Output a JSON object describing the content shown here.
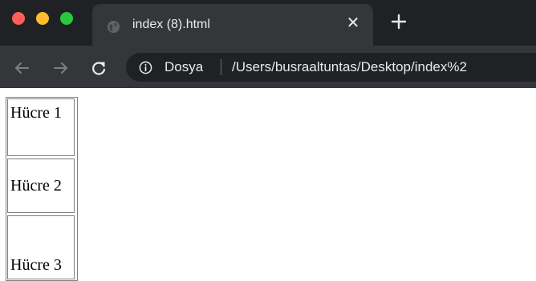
{
  "browser": {
    "tab": {
      "title": "index (8).html",
      "close_glyph": "✕"
    },
    "toolbar": {
      "icons": [
        "back-arrow-icon",
        "forward-arrow-icon",
        "reload-icon"
      ],
      "omnibox": {
        "scheme_label": "Dosya",
        "url": "/Users/busraaltuntas/Desktop/index%2"
      }
    },
    "window_controls": [
      "close",
      "minimize",
      "zoom"
    ],
    "colors": {
      "tabstrip": "#202124",
      "active_tab": "#35363a",
      "toolbar": "#35363a",
      "omnibox": "#202124",
      "text": "#e8eaed",
      "traffic_red": "#ff5f57",
      "traffic_yellow": "#febc2e",
      "traffic_green": "#28c840"
    }
  },
  "page": {
    "table": {
      "cells": [
        "Hücre 1",
        "Hücre 2",
        "Hücre 3"
      ]
    }
  }
}
